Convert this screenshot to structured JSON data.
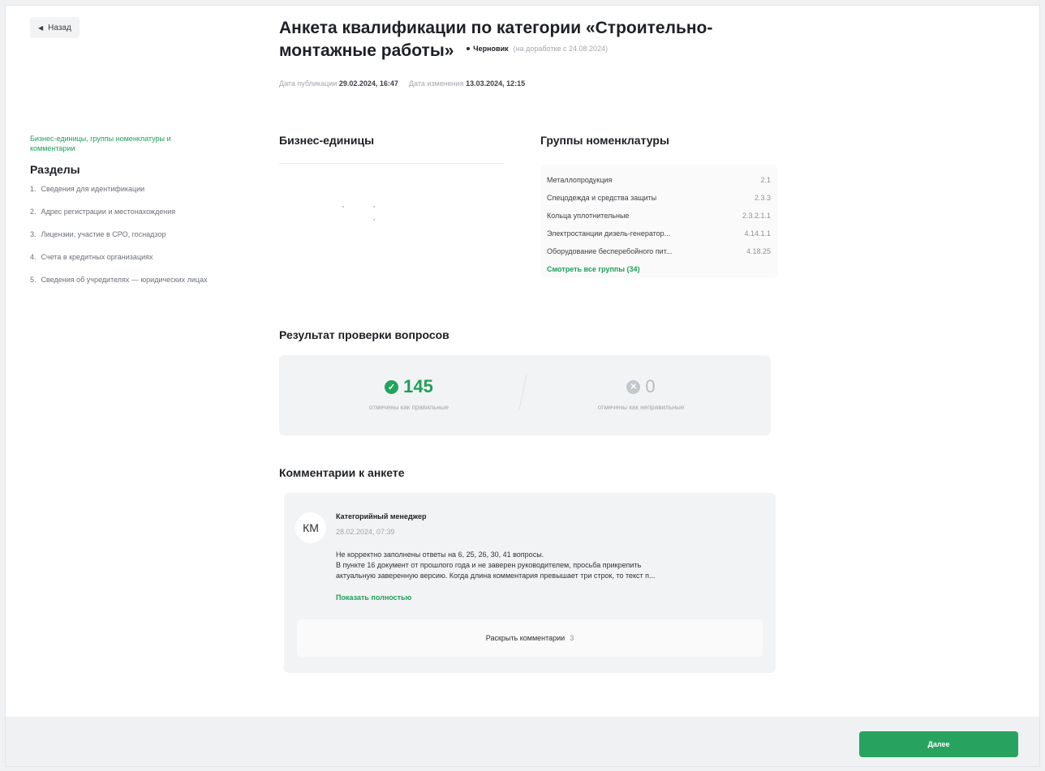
{
  "header": {
    "back_label": "Назад",
    "title": "Анкета квалификации по категории «Строительно-монтажные работы»",
    "status": "Черновик",
    "status_note": "(на доработке с 24.08.2024)",
    "published_label": "Дата публикации",
    "published_value": "29.02.2024, 16:47",
    "modified_label": "Дата изменения",
    "modified_value": "13.03.2024, 12:15"
  },
  "sidebar": {
    "top_link": "Бизнес-единицы, группы номенклатуры и комментарии",
    "heading": "Разделы",
    "items": [
      {
        "num": "1.",
        "label": "Сведения для идентификации"
      },
      {
        "num": "2.",
        "label": "Адрес регистрации и местонахождения"
      },
      {
        "num": "3.",
        "label": "Лицензии, участие в СРО, госнадзор"
      },
      {
        "num": "4.",
        "label": "Счета в кредитных организациях"
      },
      {
        "num": "5.",
        "label": "Сведения об учредителях — юридических лицах"
      }
    ]
  },
  "business_units": {
    "heading": "Бизнес-единицы"
  },
  "nomenclature": {
    "heading": "Группы номенклатуры",
    "rows": [
      {
        "name": "Металлопродукция",
        "code": "2.1"
      },
      {
        "name": "Спецодежда и средства защиты",
        "code": "2.3.3"
      },
      {
        "name": "Кольца уплотнительные",
        "code": "2.3.2.1.1"
      },
      {
        "name": "Электростанции дизель-генератор...",
        "code": "4.14.1.1"
      },
      {
        "name": "Оборудование бесперебойного пит...",
        "code": "4.18.25"
      }
    ],
    "all_link": "Смотреть все группы (34)"
  },
  "results": {
    "heading": "Результат проверки вопросов",
    "correct_value": "145",
    "correct_label": "отмечены как правильные",
    "incorrect_value": "0",
    "incorrect_label": "отмечены как неправильные"
  },
  "comments": {
    "heading": "Комментарии к анкете",
    "avatar_initials": "КМ",
    "author": "Категорийный менеджер",
    "date": "28.02.2024, 07:39",
    "text_lines": [
      "Не корректно заполнены ответы на 6, 25, 26, 30, 41 вопросы.",
      "В пункте 16 документ от прошлого года и не заверен руководителем, просьба прикрепить",
      "актуальную заверенную версию. Когда длина комментария превышает три строк, то текст п..."
    ],
    "show_full": "Показать полностью",
    "expand_label": "Раскрыть комментарии",
    "expand_count": "3"
  },
  "footer": {
    "next_label": "Далее"
  },
  "colors": {
    "accent": "#27a35f",
    "link": "#1ea05a",
    "muted": "#a3a7ad",
    "panel": "#f2f3f4"
  }
}
